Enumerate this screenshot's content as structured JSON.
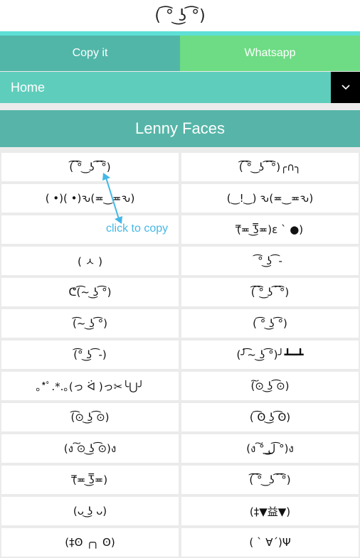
{
  "preview": {
    "face": "( ͡° ͜ʖ ͡°)"
  },
  "actions": {
    "copy_label": "Copy it",
    "whatsapp_label": "Whatsapp"
  },
  "nav": {
    "current": "Home",
    "toggle_icon": "chevron-down-icon"
  },
  "section": {
    "title": "Lenny Faces"
  },
  "tooltip": {
    "text": "click to copy",
    "color": "#45b7e6"
  },
  "colors": {
    "copy_button": "#51b6a8",
    "whatsapp_button": "#6ddc84",
    "nav_bar": "#5fcdbc",
    "section_header": "#56b5a8",
    "accent_bar": "#5ee0d6"
  },
  "faces": [
    [
      "(͡ ͡° ͜ ʖ ͡ ͡°)",
      "(͡ ͡° ͜ ʖ ͡ ͡°)╭∩╮"
    ],
    [
      "( •)( •)ԅ(≖‿≖ԅ)",
      "(‿!‿) ԅ(≖‿≖ԅ)"
    ],
    [
      "",
      "(̿≖ ͜ʖ̿≖)ε ` ●)"
    ],
    [
      "( ㅅ )",
      "͡° ͜ʖ ͡ -"
    ],
    [
      "ᕦ(͡~ ͜ʖ ͡°)",
      "(͡ ͡°͜ ʖ ͡ ͡°)"
    ],
    [
      "(͡~ ͜ʖ ͡°)",
      "( ͡° ͜ʖ ͡°)"
    ],
    [
      "(͡° ͜ʖ ͡ -)",
      "(╯͡~ ͜ʖ ͡°)╯┻━┻"
    ],
    [
      "｡*ﾟ.*.｡(っ ᐛ )っ✂╰⋃╯",
      "(͠⊙ ͜ʖ ͡⊙)"
    ],
    [
      "(͡⊙ ͜ʖ ͡⊙)",
      "( ͡ʘ ͜ʖ ͡ʘ)"
    ],
    [
      "(ง ͠⊙ ͜ʖ ͡⊙)ง",
      "(ง ͠° ͟ل͜ ͡°)ง"
    ],
    [
      "(̿≖ ͜ʖ̿≖)",
      "(͡ ͡° ͜ ʖ ͡ ͡°)"
    ],
    [
      "(ᴗ ͜ʖ ᴗ)",
      "(‡▼益▼)"
    ],
    [
      "(‡ʘ ╭╮ ʘ)",
      "( ` ∀´)Ψ"
    ]
  ]
}
